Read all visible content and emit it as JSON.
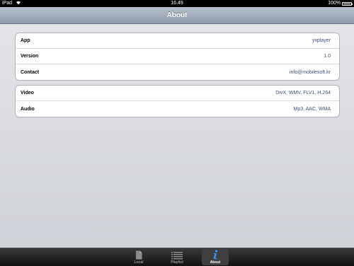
{
  "status_bar": {
    "device": "iPad",
    "time": "16.49",
    "battery": "100%"
  },
  "nav": {
    "title": "About"
  },
  "groups": [
    {
      "rows": [
        {
          "label": "App",
          "value": "yxplayer"
        },
        {
          "label": "Version",
          "value": "1.0"
        },
        {
          "label": "Contact",
          "value": "info@mobilesoft.kr"
        }
      ]
    },
    {
      "rows": [
        {
          "label": "Video",
          "value": "DivX, WMV, FLV1, H.264"
        },
        {
          "label": "Audio",
          "value": "Mp3, AAC, WMA"
        }
      ]
    }
  ],
  "tabs": [
    {
      "label": "Local",
      "icon": "document-icon",
      "active": false
    },
    {
      "label": "Playlist",
      "icon": "list-icon",
      "active": false
    },
    {
      "label": "About",
      "icon": "info-icon",
      "active": true
    }
  ],
  "colors": {
    "value_text": "#3b4f7e",
    "nav_top": "#b9c3cf",
    "nav_bottom": "#8e9aab"
  }
}
